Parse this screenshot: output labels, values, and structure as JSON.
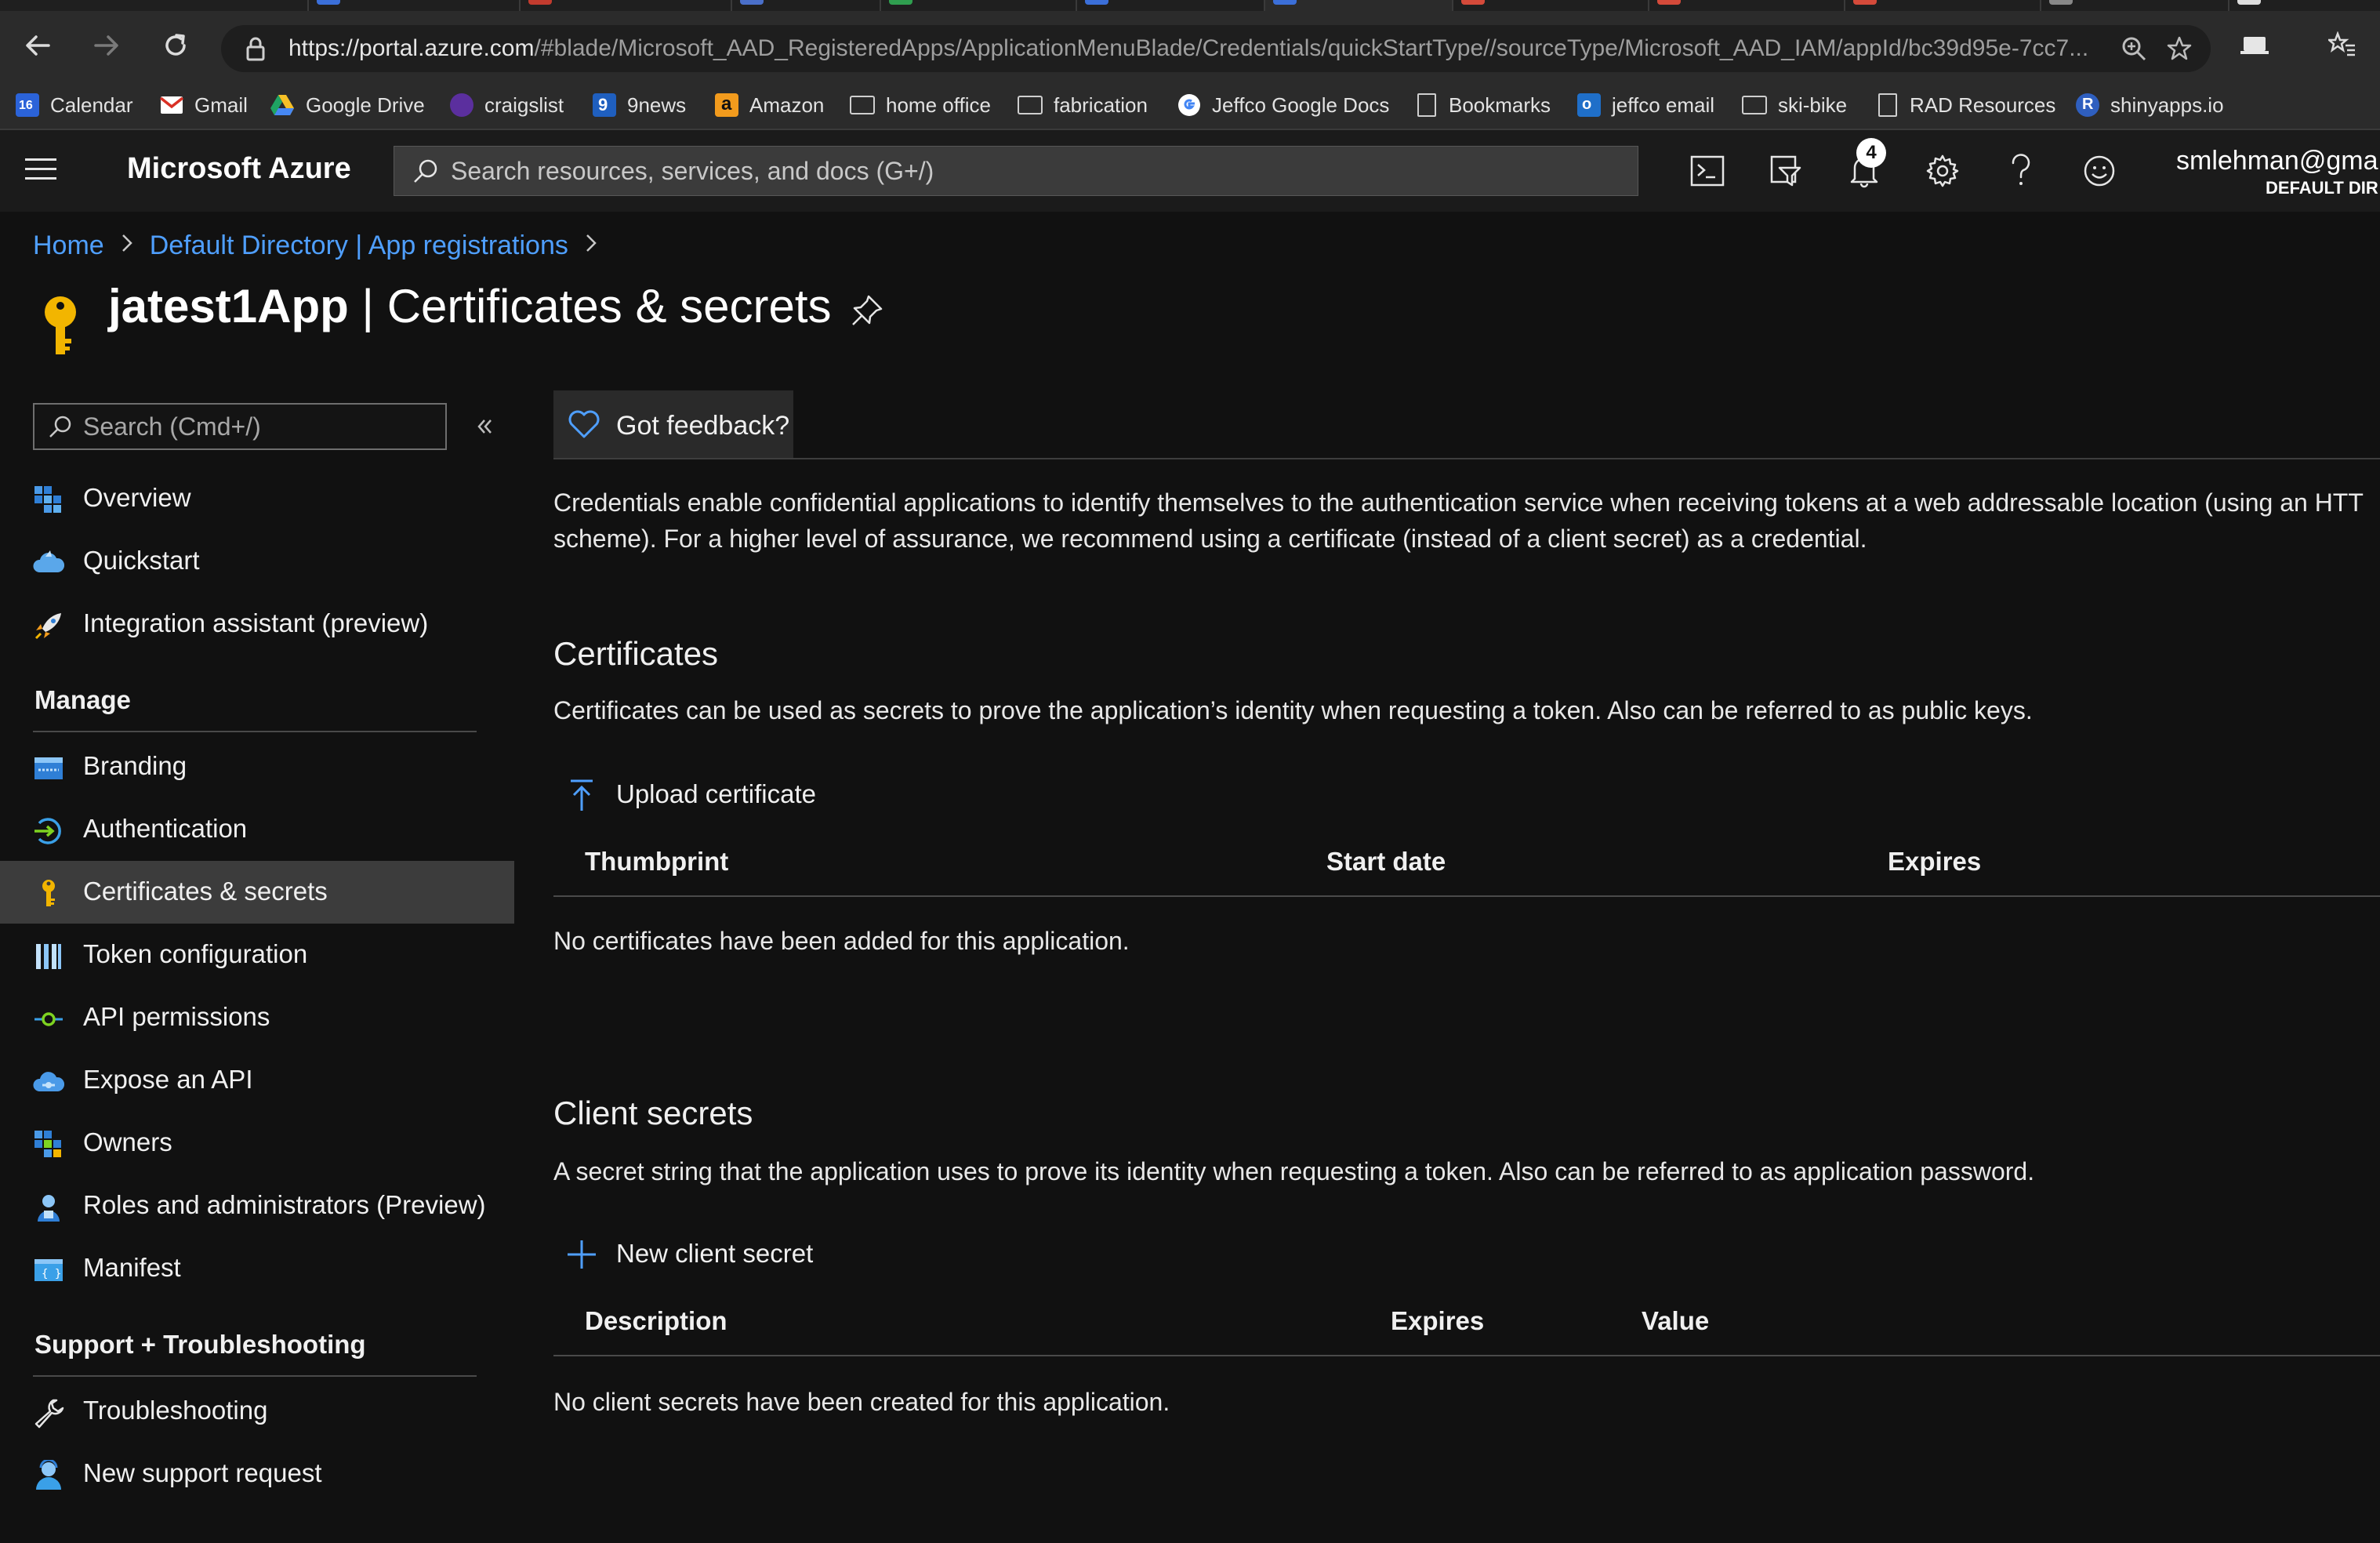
{
  "browser": {
    "url_host": "https://portal.azure.com",
    "url_path": "/#blade/Microsoft_AAD_RegisteredApps/ApplicationMenuBlade/Credentials/quickStartType//sourceType/Microsoft_AAD_IAM/appId/bc39d95e-7cc7...",
    "bookmarks": [
      {
        "label": "Calendar",
        "icon": "calendar-icon"
      },
      {
        "label": "Gmail",
        "icon": "gmail-icon"
      },
      {
        "label": "Google Drive",
        "icon": "google-drive-icon"
      },
      {
        "label": "craigslist",
        "icon": "craigslist-icon"
      },
      {
        "label": "9news",
        "icon": "9news-icon"
      },
      {
        "label": "Amazon",
        "icon": "amazon-icon"
      },
      {
        "label": "home office",
        "icon": "folder-icon"
      },
      {
        "label": "fabrication",
        "icon": "folder-icon"
      },
      {
        "label": "Jeffco Google Docs",
        "icon": "google-icon"
      },
      {
        "label": "Bookmarks",
        "icon": "page-icon"
      },
      {
        "label": "jeffco email",
        "icon": "outlook-icon"
      },
      {
        "label": "ski-bike",
        "icon": "folder-icon"
      },
      {
        "label": "RAD Resources",
        "icon": "page-icon"
      },
      {
        "label": "shinyapps.io",
        "icon": "r-icon"
      }
    ],
    "calendar_day": "16"
  },
  "azure": {
    "brand": "Microsoft Azure",
    "search_placeholder": "Search resources, services, and docs (G+/)",
    "notification_count": "4",
    "user_name": "smlehman@gma",
    "user_directory": "DEFAULT DIR"
  },
  "breadcrumb": {
    "home": "Home",
    "directory": "Default Directory | App registrations"
  },
  "page": {
    "app_name": "jatest1App",
    "separator": " | ",
    "blade_name": "Certificates & secrets"
  },
  "nav": {
    "search_placeholder": "Search (Cmd+/)",
    "top_items": [
      {
        "label": "Overview",
        "icon": "overview-grid-icon"
      },
      {
        "label": "Quickstart",
        "icon": "quickstart-cloud-icon"
      },
      {
        "label": "Integration assistant (preview)",
        "icon": "rocket-icon"
      }
    ],
    "manage_label": "Manage",
    "manage_items": [
      {
        "label": "Branding",
        "icon": "branding-icon"
      },
      {
        "label": "Authentication",
        "icon": "authentication-icon"
      },
      {
        "label": "Certificates & secrets",
        "icon": "key-icon",
        "selected": true
      },
      {
        "label": "Token configuration",
        "icon": "token-bars-icon"
      },
      {
        "label": "API permissions",
        "icon": "api-permissions-icon"
      },
      {
        "label": "Expose an API",
        "icon": "expose-api-cloud-icon"
      },
      {
        "label": "Owners",
        "icon": "owners-grid-icon"
      },
      {
        "label": "Roles and administrators (Preview)",
        "icon": "roles-person-icon"
      },
      {
        "label": "Manifest",
        "icon": "manifest-icon"
      }
    ],
    "support_label": "Support + Troubleshooting",
    "support_items": [
      {
        "label": "Troubleshooting",
        "icon": "wrench-icon"
      },
      {
        "label": "New support request",
        "icon": "support-person-icon"
      }
    ]
  },
  "main": {
    "feedback_label": "Got feedback?",
    "intro_line1": "Credentials enable confidential applications to identify themselves to the authentication service when receiving tokens at a web addressable location (using an HTT",
    "intro_line2": "scheme). For a higher level of assurance, we recommend using a certificate (instead of a client secret) as a credential.",
    "certificates": {
      "title": "Certificates",
      "description": "Certificates can be used as secrets to prove the application’s identity when requesting a token. Also can be referred to as public keys.",
      "action_label": "Upload certificate",
      "columns": [
        "Thumbprint",
        "Start date",
        "Expires"
      ],
      "empty_message": "No certificates have been added for this application."
    },
    "client_secrets": {
      "title": "Client secrets",
      "description": "A secret string that the application uses to prove its identity when requesting a token. Also can be referred to as application password.",
      "action_label": "New client secret",
      "columns": [
        "Description",
        "Expires",
        "Value"
      ],
      "empty_message": "No client secrets have been created for this application."
    }
  },
  "colors": {
    "link_blue": "#4f9fff",
    "key_yellow": "#f2b500",
    "selected_bg": "#3c3c3c",
    "page_bg": "#111111"
  }
}
